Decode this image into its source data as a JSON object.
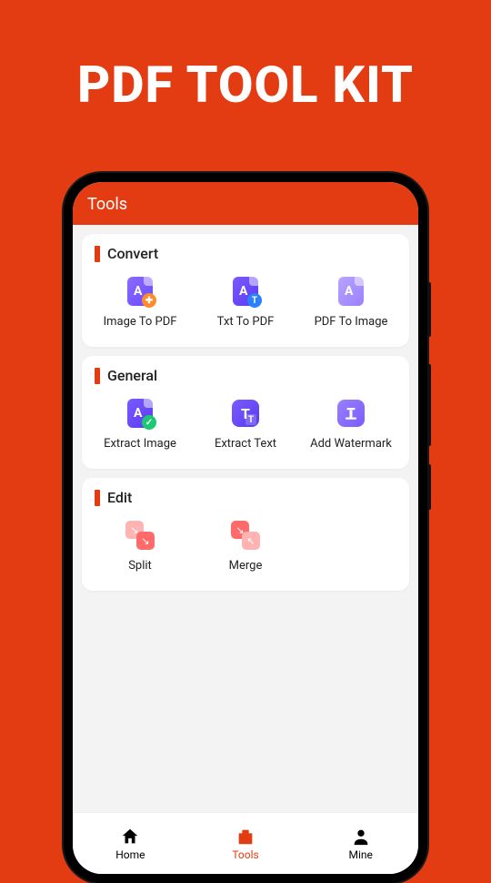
{
  "hero": {
    "title": "PDF TOOL KIT"
  },
  "appbar": {
    "title": "Tools"
  },
  "sections": {
    "convert": {
      "title": "Convert",
      "items": [
        {
          "label": "Image To PDF"
        },
        {
          "label": "Txt To PDF"
        },
        {
          "label": "PDF To Image"
        }
      ]
    },
    "general": {
      "title": "General",
      "items": [
        {
          "label": "Extract Image"
        },
        {
          "label": "Extract Text"
        },
        {
          "label": "Add Watermark"
        }
      ]
    },
    "edit": {
      "title": "Edit",
      "items": [
        {
          "label": "Split"
        },
        {
          "label": "Merge"
        }
      ]
    }
  },
  "nav": {
    "home": "Home",
    "tools": "Tools",
    "mine": "Mine"
  }
}
